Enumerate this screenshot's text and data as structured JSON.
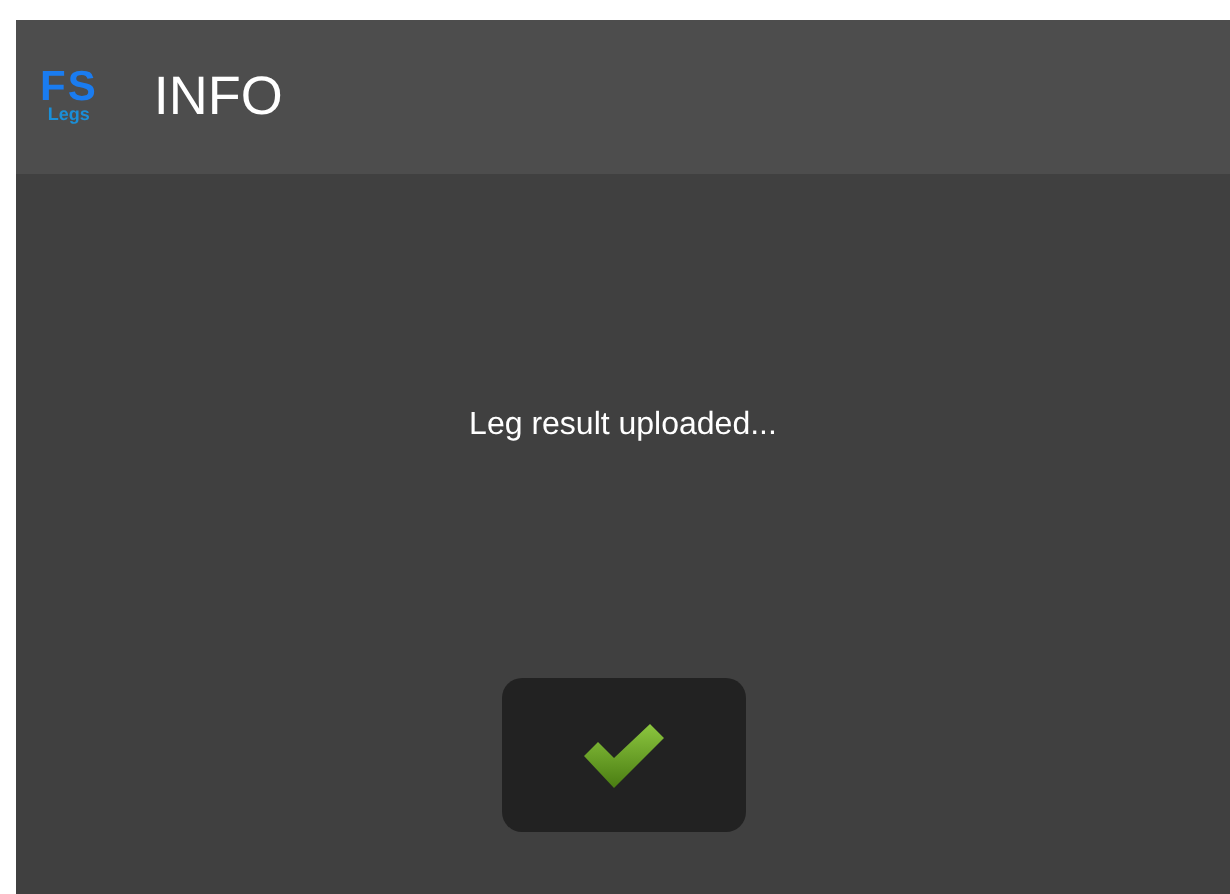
{
  "logo": {
    "top": "FS",
    "bottom": "Legs"
  },
  "window": {
    "title": "INFO"
  },
  "message": "Leg result uploaded...",
  "buttons": [
    {
      "kind": "confirm"
    }
  ]
}
